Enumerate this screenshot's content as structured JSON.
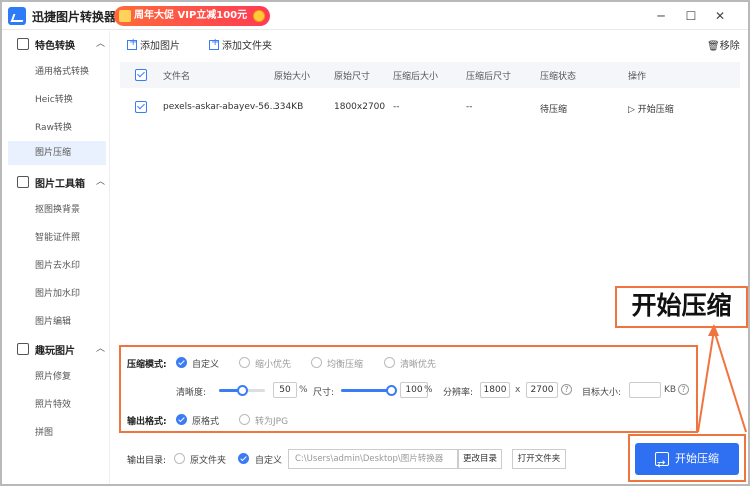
{
  "app": {
    "title": "迅捷图片转换器",
    "promo": "周年大促 VIP立减100元"
  },
  "window_controls": [
    "─",
    "☐",
    "✕"
  ],
  "sidebar": {
    "groups": [
      {
        "label": "特色转换",
        "items": [
          "通用格式转换",
          "Heic转换",
          "Raw转换",
          "图片压缩"
        ]
      },
      {
        "label": "图片工具箱",
        "items": [
          "抠图换背景",
          "智能证件照",
          "图片去水印",
          "图片加水印",
          "图片编辑"
        ]
      },
      {
        "label": "趣玩图片",
        "items": [
          "照片修复",
          "照片特效",
          "拼图"
        ]
      }
    ],
    "active_item": "图片压缩"
  },
  "toolbar": {
    "add_image": "添加图片",
    "add_folder": "添加文件夹",
    "remove": "移除"
  },
  "table": {
    "headers": [
      "文件名",
      "原始大小",
      "原始尺寸",
      "压缩后大小",
      "压缩后尺寸",
      "压缩状态",
      "操作"
    ],
    "rows": [
      {
        "name": "pexels-askar-abayev-56...",
        "orig_size": "334KB",
        "orig_dim": "1800x2700",
        "new_size": "--",
        "new_dim": "--",
        "status": "待压缩",
        "action": "开始压缩"
      }
    ]
  },
  "settings": {
    "mode_label": "压缩模式:",
    "modes": [
      "自定义",
      "缩小优先",
      "均衡压缩",
      "清晰优先"
    ],
    "selected_mode": "自定义",
    "clarity_label": "清晰度:",
    "clarity_value": "50",
    "size_label": "尺寸:",
    "size_value": "100",
    "percent": "%",
    "resolution_label": "分辨率:",
    "res_w": "1800",
    "res_x": "x",
    "res_h": "2700",
    "target_label": "目标大小:",
    "target_unit": "KB",
    "clarity_level": 0.5,
    "size_level": 1.0,
    "format_label": "输出格式:",
    "formats": [
      "原格式",
      "转为JPG"
    ],
    "selected_format": "原格式"
  },
  "output": {
    "label": "输出目录:",
    "options": [
      "原文件夹",
      "自定义"
    ],
    "selected": "自定义",
    "path": "C:\\Users\\admin\\Desktop\\图片转换器",
    "change_btn": "更改目录",
    "open_btn": "打开文件夹"
  },
  "start_button": "开始压缩",
  "callout_text": "开始压缩",
  "colors": {
    "accent": "#2f6ff2",
    "highlight": "#f07440"
  }
}
